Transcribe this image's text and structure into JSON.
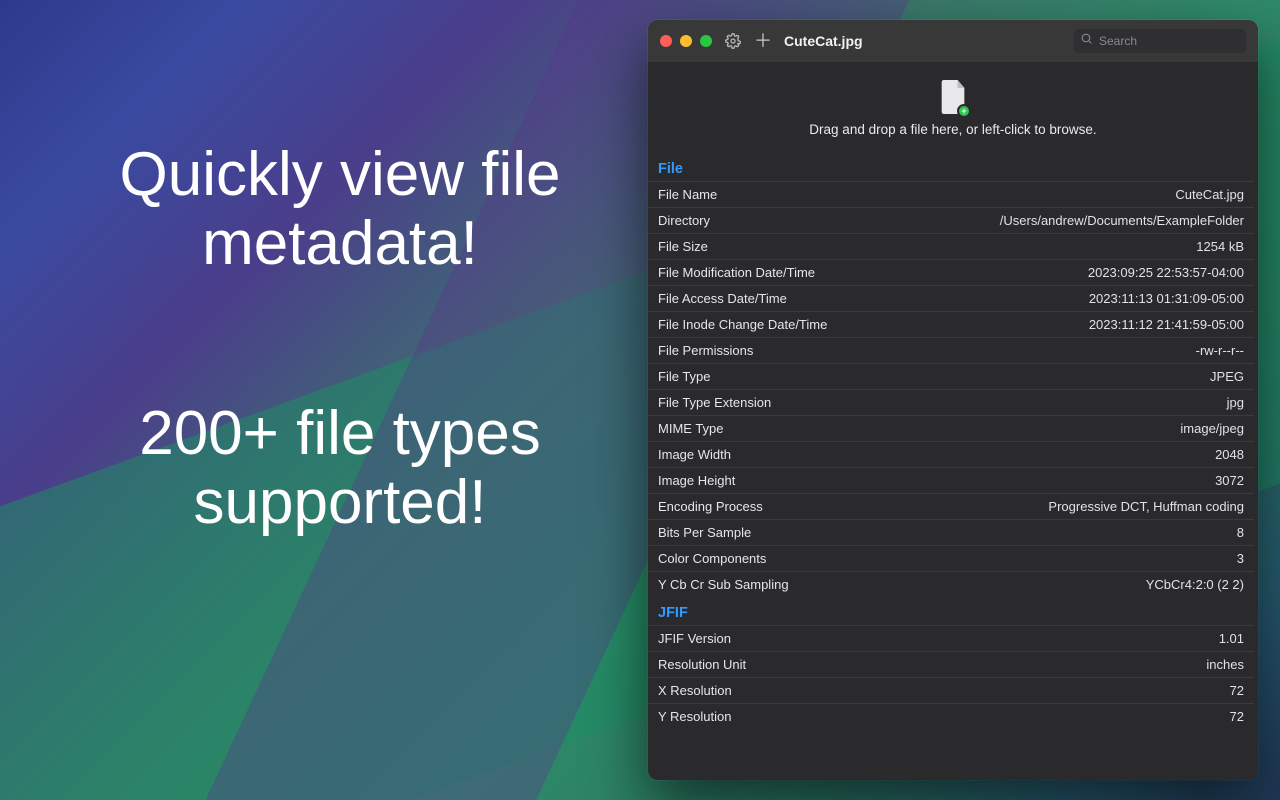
{
  "promo": {
    "line1": "Quickly view file metadata!",
    "line2": "200+ file types supported!"
  },
  "window": {
    "title": "CuteCat.jpg",
    "search_placeholder": "Search",
    "dropzone_text": "Drag and drop a file here, or left-click to browse."
  },
  "sections": [
    {
      "title": "File",
      "rows": [
        {
          "label": "File Name",
          "value": "CuteCat.jpg"
        },
        {
          "label": "Directory",
          "value": "/Users/andrew/Documents/ExampleFolder"
        },
        {
          "label": "File Size",
          "value": "1254 kB"
        },
        {
          "label": "File Modification Date/Time",
          "value": "2023:09:25 22:53:57-04:00"
        },
        {
          "label": "File Access Date/Time",
          "value": "2023:11:13 01:31:09-05:00"
        },
        {
          "label": "File Inode Change Date/Time",
          "value": "2023:11:12 21:41:59-05:00"
        },
        {
          "label": "File Permissions",
          "value": "-rw-r--r--"
        },
        {
          "label": "File Type",
          "value": "JPEG"
        },
        {
          "label": "File Type Extension",
          "value": "jpg"
        },
        {
          "label": "MIME Type",
          "value": "image/jpeg"
        },
        {
          "label": "Image Width",
          "value": "2048"
        },
        {
          "label": "Image Height",
          "value": "3072"
        },
        {
          "label": "Encoding Process",
          "value": "Progressive DCT, Huffman coding"
        },
        {
          "label": "Bits Per Sample",
          "value": "8"
        },
        {
          "label": "Color Components",
          "value": "3"
        },
        {
          "label": "Y Cb Cr Sub Sampling",
          "value": "YCbCr4:2:0 (2 2)"
        }
      ]
    },
    {
      "title": "JFIF",
      "rows": [
        {
          "label": "JFIF Version",
          "value": "1.01"
        },
        {
          "label": "Resolution Unit",
          "value": "inches"
        },
        {
          "label": "X Resolution",
          "value": "72"
        },
        {
          "label": "Y Resolution",
          "value": "72"
        }
      ]
    }
  ]
}
